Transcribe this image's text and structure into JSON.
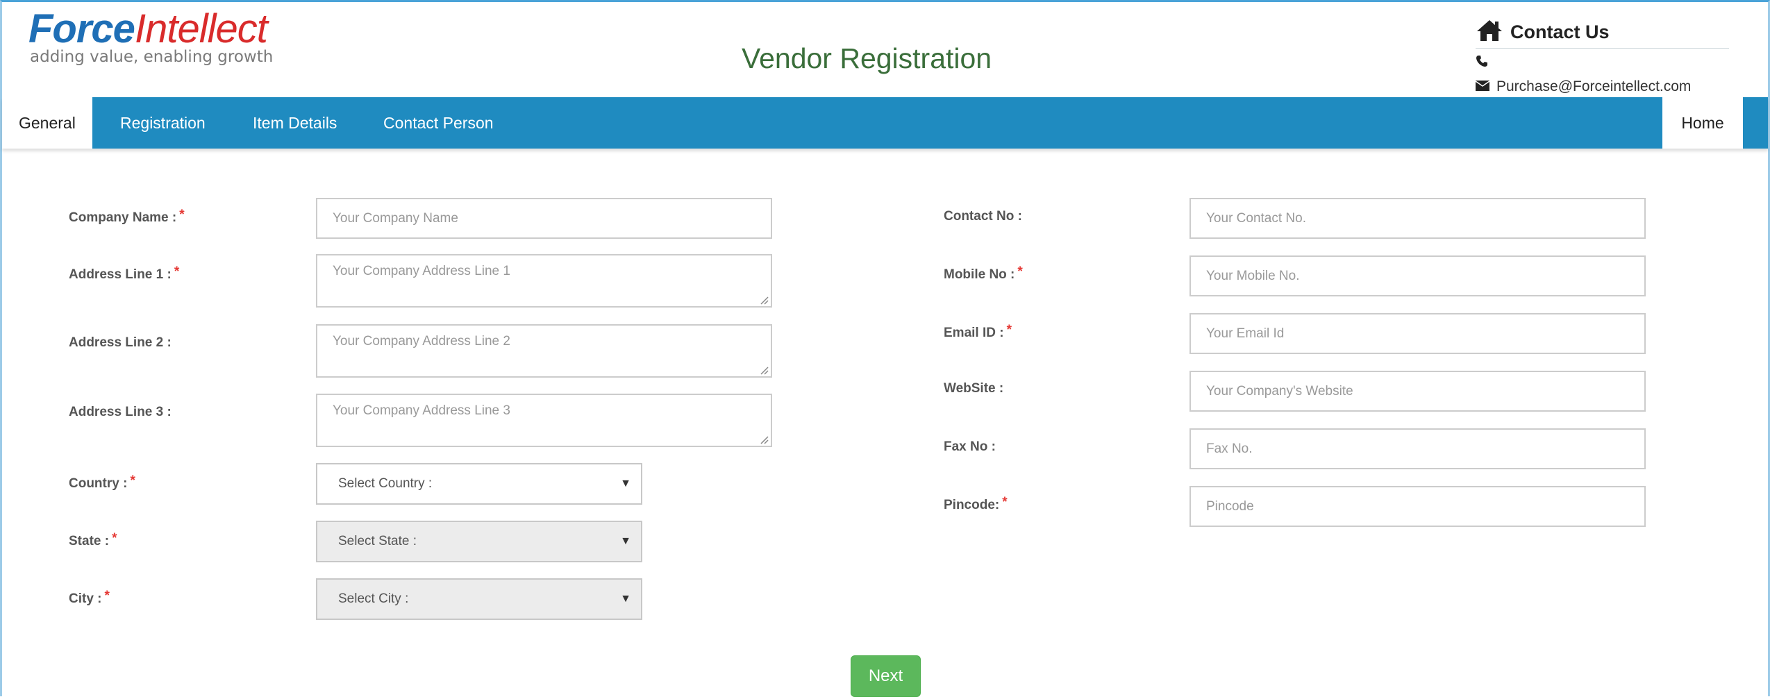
{
  "header": {
    "logo_force": "Force",
    "logo_intellect": "Intellect",
    "logo_tagline": "adding value, enabling growth",
    "page_title": "Vendor Registration"
  },
  "contact": {
    "title": "Contact Us",
    "phone": "",
    "email": "Purchase@Forceintellect.com"
  },
  "nav": {
    "tabs": [
      {
        "label": "General",
        "active": true
      },
      {
        "label": "Registration",
        "active": false
      },
      {
        "label": "Item Details",
        "active": false
      },
      {
        "label": "Contact Person",
        "active": false
      }
    ],
    "home": "Home"
  },
  "form": {
    "company_name": {
      "label": "Company Name :",
      "required": "*",
      "placeholder": "Your Company Name"
    },
    "address1": {
      "label": "Address Line 1 :",
      "required": "*",
      "placeholder": "Your Company Address Line 1"
    },
    "address2": {
      "label": "Address Line 2 :",
      "placeholder": "Your Company Address Line 2"
    },
    "address3": {
      "label": "Address Line 3 :",
      "placeholder": "Your Company Address Line 3"
    },
    "country": {
      "label": "Country :",
      "required": "*",
      "selected": "Select Country :"
    },
    "state": {
      "label": "State :",
      "required": "*",
      "selected": "Select State :"
    },
    "city": {
      "label": "City :",
      "required": "*",
      "selected": "Select City :"
    },
    "contact_no": {
      "label": "Contact No :",
      "placeholder": "Your Contact No."
    },
    "mobile_no": {
      "label": "Mobile No :",
      "required": "*",
      "placeholder": "Your Mobile No."
    },
    "email_id": {
      "label": "Email ID :",
      "required": "*",
      "placeholder": "Your Email Id"
    },
    "website": {
      "label": "WebSite :",
      "placeholder": "Your Company's Website"
    },
    "fax_no": {
      "label": "Fax No :",
      "placeholder": "Fax No."
    },
    "pincode": {
      "label": "Pincode:",
      "required": "*",
      "placeholder": "Pincode"
    }
  },
  "actions": {
    "next": "Next"
  },
  "colors": {
    "brand_blue": "#1f6fb6",
    "brand_red": "#d92b2b",
    "nav_bg": "#1f8bc0",
    "title_green": "#3a6e3a",
    "required_red": "#e53935",
    "button_green": "#5cb85c"
  },
  "icons": {
    "home": "home-icon",
    "phone": "phone-icon",
    "email": "envelope-icon",
    "dropdown": "caret-down-icon"
  }
}
